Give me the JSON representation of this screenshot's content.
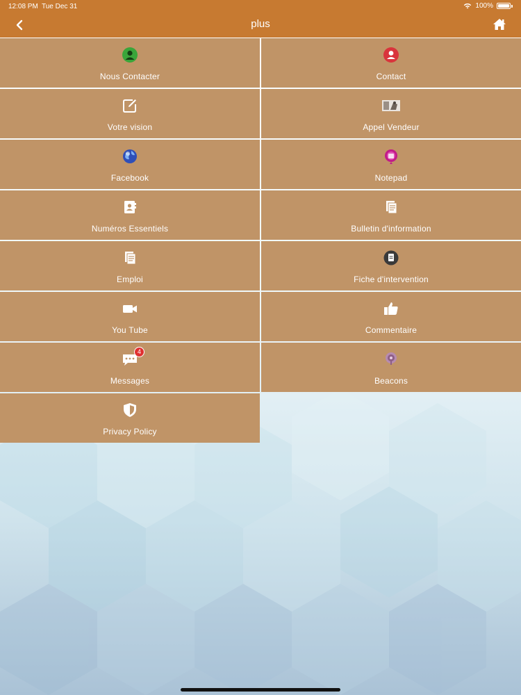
{
  "status_bar": {
    "time": "12:08 PM",
    "date": "Tue Dec 31",
    "battery": "100%"
  },
  "header": {
    "title": "plus",
    "back_icon": "chevron-left-icon",
    "home_icon": "home-icon"
  },
  "colors": {
    "header": "#c77a31",
    "tile": "#c09467",
    "badge": "#e03131"
  },
  "menu": [
    {
      "label": "Nous Contacter",
      "icon": "contact-person-green-icon"
    },
    {
      "label": "Contact",
      "icon": "person-red-circle-icon"
    },
    {
      "label": "Votre vision",
      "icon": "edit-icon"
    },
    {
      "label": "Appel Vendeur",
      "icon": "seller-photo-icon"
    },
    {
      "label": "Facebook",
      "icon": "globe-icon"
    },
    {
      "label": "Notepad",
      "icon": "notepad-pink-icon"
    },
    {
      "label": "Numéros Essentiels",
      "icon": "address-book-icon"
    },
    {
      "label": "Bulletin d'information",
      "icon": "documents-icon"
    },
    {
      "label": "Emploi",
      "icon": "documents-icon"
    },
    {
      "label": "Fiche d'intervention",
      "icon": "doc-circle-icon"
    },
    {
      "label": "You Tube",
      "icon": "video-camera-icon"
    },
    {
      "label": "Commentaire",
      "icon": "thumbs-up-icon"
    },
    {
      "label": "Messages",
      "icon": "chat-bubble-icon",
      "badge": "4"
    },
    {
      "label": "Beacons",
      "icon": "beacon-icon"
    },
    {
      "label": "Privacy Policy",
      "icon": "shield-icon"
    }
  ]
}
